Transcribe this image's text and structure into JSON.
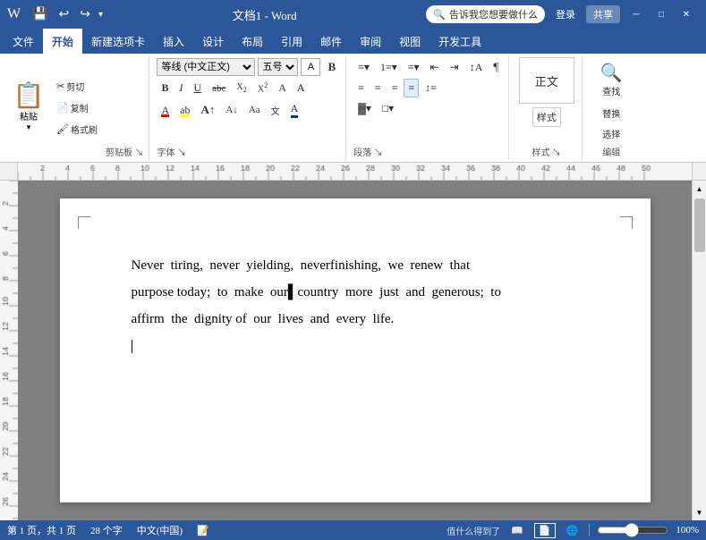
{
  "titlebar": {
    "doc_name": "文档1 - Word",
    "quick_access": [
      "save",
      "undo",
      "redo"
    ],
    "tell_me": "告诉我您想要做什么",
    "login": "登录",
    "share": "共享",
    "window_controls": [
      "minimize",
      "restore",
      "close"
    ]
  },
  "ribbon": {
    "tabs": [
      "文件",
      "开始",
      "新建选项卡",
      "插入",
      "设计",
      "布局",
      "引用",
      "邮件",
      "审阅",
      "视图",
      "开发工具"
    ],
    "active_tab": "开始",
    "groups": {
      "clipboard": {
        "label": "剪贴板",
        "paste": "粘贴",
        "cut": "✂",
        "copy": "📋",
        "format_painter": "🖌"
      },
      "font": {
        "label": "字体",
        "name": "等线 (中文正文)",
        "size": "五号",
        "size_num": "A",
        "bold": "B",
        "italic": "I",
        "underline": "U",
        "strikethrough": "abc",
        "subscript": "X₂",
        "superscript": "X²",
        "clear_format": "A",
        "font_color": "A",
        "highlight": "ab",
        "grow": "A↑",
        "shrink": "A↓",
        "case": "Aa",
        "phonetic": "文"
      },
      "paragraph": {
        "label": "段落",
        "bullets": "≡",
        "numbering": "≡",
        "outdent": "←",
        "indent": "→",
        "sort": "↕",
        "show_marks": "¶",
        "align_left": "≡",
        "center": "≡",
        "align_right": "≡",
        "justify": "≡",
        "line_spacing": "≡",
        "shading": "▓",
        "borders": "□"
      },
      "styles": {
        "label": "样式",
        "normal": "正文",
        "style_btn": "样式"
      },
      "editing": {
        "label": "编辑",
        "find": "查找",
        "replace": "替换",
        "select": "选择"
      }
    }
  },
  "document": {
    "page_content": "Never  tiring,  never  yielding,  neverfinishing,  we  renew  that  purpose  today;  to  make  our country  more  just  and  generous;  to  affirm  the  dignity  of  our  lives  and  every  life.",
    "line1": "Never  tiring,  never  yielding,  neverfinishing,  we  renew  that",
    "line2": "purpose today;  to  make  our▌country  more  just  and  generous;  to",
    "line3": "affirm  the  dignity  of  our  lives  and  every  life.",
    "cursor_line": ""
  },
  "statusbar": {
    "page_info": "第 1 页，共 1 页",
    "word_count": "28 个字",
    "language": "中文(中国)",
    "view_modes": [
      "阅读视图",
      "页面视图",
      "Web版式视图"
    ],
    "zoom_level": "100%",
    "watermark": "值什么得到了"
  },
  "icons": {
    "save": "💾",
    "undo": "↩",
    "redo": "↪",
    "search": "🔍",
    "minimize": "─",
    "restore": "□",
    "close": "✕",
    "scroll_up": "▲",
    "scroll_down": "▼",
    "view_read": "📖",
    "view_page": "📄",
    "view_web": "🌐"
  }
}
